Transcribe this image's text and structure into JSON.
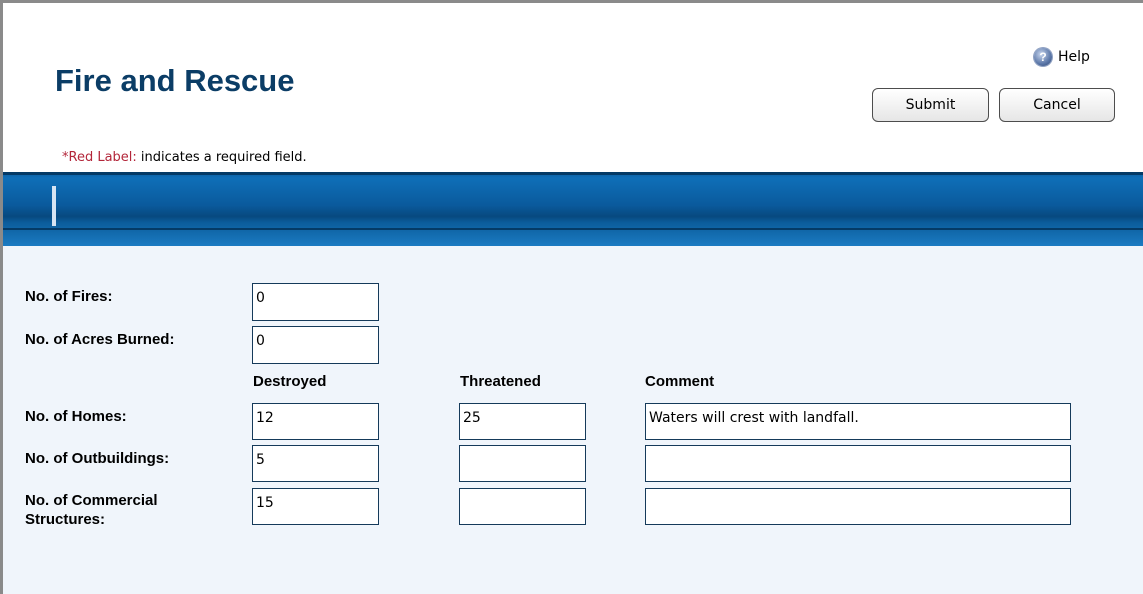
{
  "header": {
    "title": "Fire and Rescue",
    "help_label": "Help",
    "help_icon": "question-circle-icon",
    "submit_label": "Submit",
    "cancel_label": "Cancel"
  },
  "notice": {
    "required_label": "*Red Label:",
    "required_text": " indicates a required field."
  },
  "colors": {
    "title": "#0b3d66",
    "required": "#b3263a",
    "band": "#0a5a9c",
    "form_bg": "#f0f5fb"
  },
  "form": {
    "fires_label": "No. of Fires:",
    "fires_value": "0",
    "acres_label": "No. of Acres Burned:",
    "acres_value": "0",
    "columns": [
      "Destroyed",
      "Threatened",
      "Comment"
    ],
    "rows": [
      {
        "label": "No. of Homes:",
        "destroyed": "12",
        "threatened": "25",
        "comment": "Waters will crest with landfall."
      },
      {
        "label": "No. of Outbuildings:",
        "destroyed": "5",
        "threatened": "",
        "comment": ""
      },
      {
        "label_line1": "No. of Commercial",
        "label_line2": "Structures:",
        "destroyed": "15",
        "threatened": "",
        "comment": ""
      }
    ]
  }
}
